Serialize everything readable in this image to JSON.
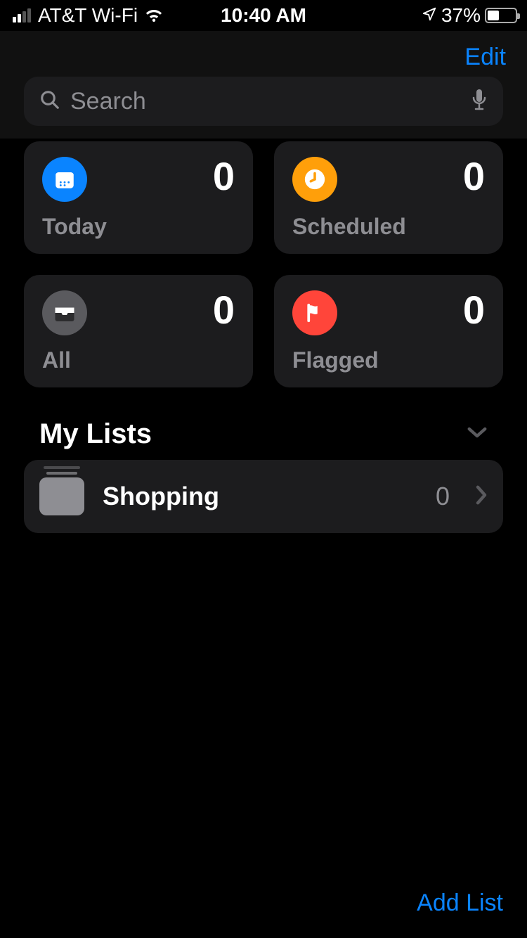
{
  "status": {
    "carrier": "AT&T Wi-Fi",
    "time": "10:40 AM",
    "battery_pct": "37%",
    "battery_fill_width": "37%"
  },
  "nav": {
    "edit_label": "Edit"
  },
  "search": {
    "placeholder": "Search"
  },
  "cards": {
    "today": {
      "label": "Today",
      "count": "0"
    },
    "scheduled": {
      "label": "Scheduled",
      "count": "0"
    },
    "all": {
      "label": "All",
      "count": "0"
    },
    "flagged": {
      "label": "Flagged",
      "count": "0"
    }
  },
  "section": {
    "title": "My Lists"
  },
  "lists": [
    {
      "name": "Shopping",
      "count": "0"
    }
  ],
  "footer": {
    "add_list_label": "Add List"
  }
}
